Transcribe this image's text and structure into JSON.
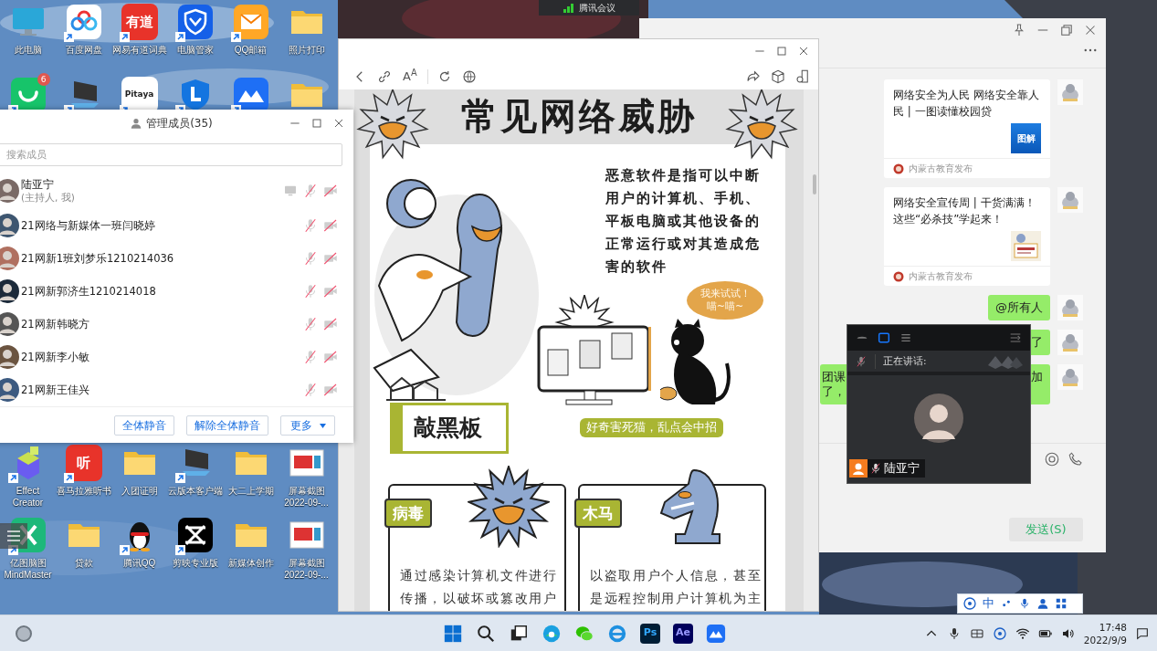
{
  "meeting_bar": {
    "title": "腾讯会议"
  },
  "desktop": {
    "rows": [
      {
        "icons": [
          {
            "kind": "pc",
            "label": "此电脑",
            "shortcut": false
          },
          {
            "kind": "cloud",
            "label": "百度网盘",
            "shortcut": true
          },
          {
            "kind": "glyph-red",
            "glyph": "有道",
            "label": "网易有道词典",
            "shortcut": true
          },
          {
            "kind": "shield-v",
            "label": "电脑管家",
            "shortcut": true
          },
          {
            "kind": "mail",
            "label": "QQ邮箱",
            "shortcut": true
          },
          {
            "kind": "folder",
            "label": "照片打印",
            "shortcut": false
          }
        ]
      },
      {
        "icons": [
          {
            "kind": "smile",
            "badge": "6",
            "shortcut": true
          },
          {
            "kind": "display",
            "shortcut": true
          },
          {
            "kind": "glyph-white",
            "glyph": "Pitaya",
            "shortcut": true
          },
          {
            "kind": "shield-l",
            "shortcut": true
          },
          {
            "kind": "meeting",
            "shortcut": true
          },
          {
            "kind": "folder",
            "shortcut": false
          }
        ]
      },
      {
        "icons": [
          {
            "kind": "cubes",
            "label": "Effect Creator",
            "shortcut": true
          },
          {
            "kind": "glyph-red",
            "glyph": "听",
            "label": "喜马拉雅听书",
            "shortcut": true
          },
          {
            "kind": "folder",
            "label": "入团证明",
            "shortcut": false
          },
          {
            "kind": "display",
            "label": "云版本客户端",
            "shortcut": true
          },
          {
            "kind": "folder",
            "label": "大二上学期",
            "shortcut": false
          },
          {
            "kind": "thumbnail",
            "label": "屏幕截图 2022-09-...",
            "shortcut": false
          }
        ]
      },
      {
        "icons": [
          {
            "kind": "mind",
            "label": "亿图脑图 MindMaster",
            "shortcut": true
          },
          {
            "kind": "folder",
            "label": "贷款",
            "shortcut": false
          },
          {
            "kind": "penguin",
            "label": "腾讯QQ",
            "shortcut": true
          },
          {
            "kind": "clip",
            "label": "剪映专业版",
            "shortcut": true
          },
          {
            "kind": "folder",
            "label": "新媒体创作",
            "shortcut": false
          },
          {
            "kind": "thumbnail",
            "label": "屏幕截图 2022-09-...",
            "shortcut": false
          }
        ]
      }
    ]
  },
  "chat_window": {
    "messages": [
      {
        "kind": "card",
        "title": "网络安全为人民 网络安全靠人民 | 一图读懂校园贷",
        "thumb": {
          "kind": "label-tile",
          "text": "图解"
        },
        "source": "内蒙古教育发布"
      },
      {
        "kind": "card",
        "title": "网络安全宣传周 | 干货满满！这些“必杀技”学起来！",
        "source": "内蒙古教育发布"
      },
      {
        "kind": "bubble",
        "right_lines": [
          "@所有人"
        ]
      },
      {
        "kind": "bubble",
        "right_lines": [
          "了"
        ]
      },
      {
        "kind": "bubble",
        "left_lines": [
          "团课",
          "了，"
        ],
        "right_lines": [
          "加"
        ]
      }
    ],
    "send_button": "发送(S)"
  },
  "article_window": {
    "toolbar": {
      "text_size": "A$^{A}$"
    },
    "infographic": {
      "title": "常见网络威胁",
      "intro": "恶意软件是指可以中断用户的计算机、手机、平板电脑或其他设备的正常运行或对其造成危害的软件",
      "speech_lines": [
        "我来试试！",
        "喵~喵~"
      ],
      "caption": "好奇害死猫，乱点会中招",
      "section_heading": "敲黑板",
      "cards": [
        {
          "kind": "virus",
          "tag": "病毒",
          "text": "通过感染计算机文件进行传播，以破坏或篡改用户"
        },
        {
          "kind": "trojan",
          "tag": "木马",
          "text": "以盗取用户个人信息，甚至是远程控制用户计算机为主"
        }
      ]
    }
  },
  "members_window": {
    "title": "管理成员(35)",
    "search": {
      "placeholder": "搜索成员"
    },
    "members": [
      {
        "name": "陆亚宁",
        "subtitle": "(主持人, 我)",
        "kind": "host",
        "mic_muted": true,
        "camera_off": true
      },
      {
        "name": "21网络与新媒体一班闫晓婷",
        "kind": "member",
        "mic_muted": true,
        "camera_off": true
      },
      {
        "name": "21网新1班刘梦乐1210214036",
        "kind": "member",
        "mic_muted": true,
        "camera_off": true
      },
      {
        "name": "21网新郭济生1210214018",
        "kind": "member",
        "mic_muted": true,
        "camera_off": true
      },
      {
        "name": "21网新韩晓方",
        "kind": "member",
        "mic_muted": true,
        "camera_off": true
      },
      {
        "name": "21网新李小敏",
        "kind": "member",
        "mic_muted": true,
        "camera_off": true
      },
      {
        "name": "21网新王佳兴",
        "kind": "member",
        "mic_muted": true,
        "camera_off": true
      }
    ],
    "buttons": [
      "全体静音",
      "解除全体静音"
    ],
    "more_button": "更多"
  },
  "video_window": {
    "speaking_label": "正在讲话:",
    "speaking_mic_muted": true,
    "speaker": {
      "name": "陆亚宁",
      "mic_muted": true
    }
  },
  "ime_bar": {
    "language": "中"
  },
  "taskbar": {
    "pinned": [
      {
        "kind": "windows"
      },
      {
        "kind": "search"
      },
      {
        "kind": "task-view"
      },
      {
        "kind": "edge"
      },
      {
        "kind": "wechat"
      },
      {
        "kind": "ie"
      },
      {
        "kind": "ps",
        "glyph": "Ps"
      },
      {
        "kind": "ae",
        "glyph": "Ae"
      },
      {
        "kind": "meeting"
      }
    ],
    "clock": {
      "time": "17:48",
      "date": "2022/9/9"
    }
  }
}
